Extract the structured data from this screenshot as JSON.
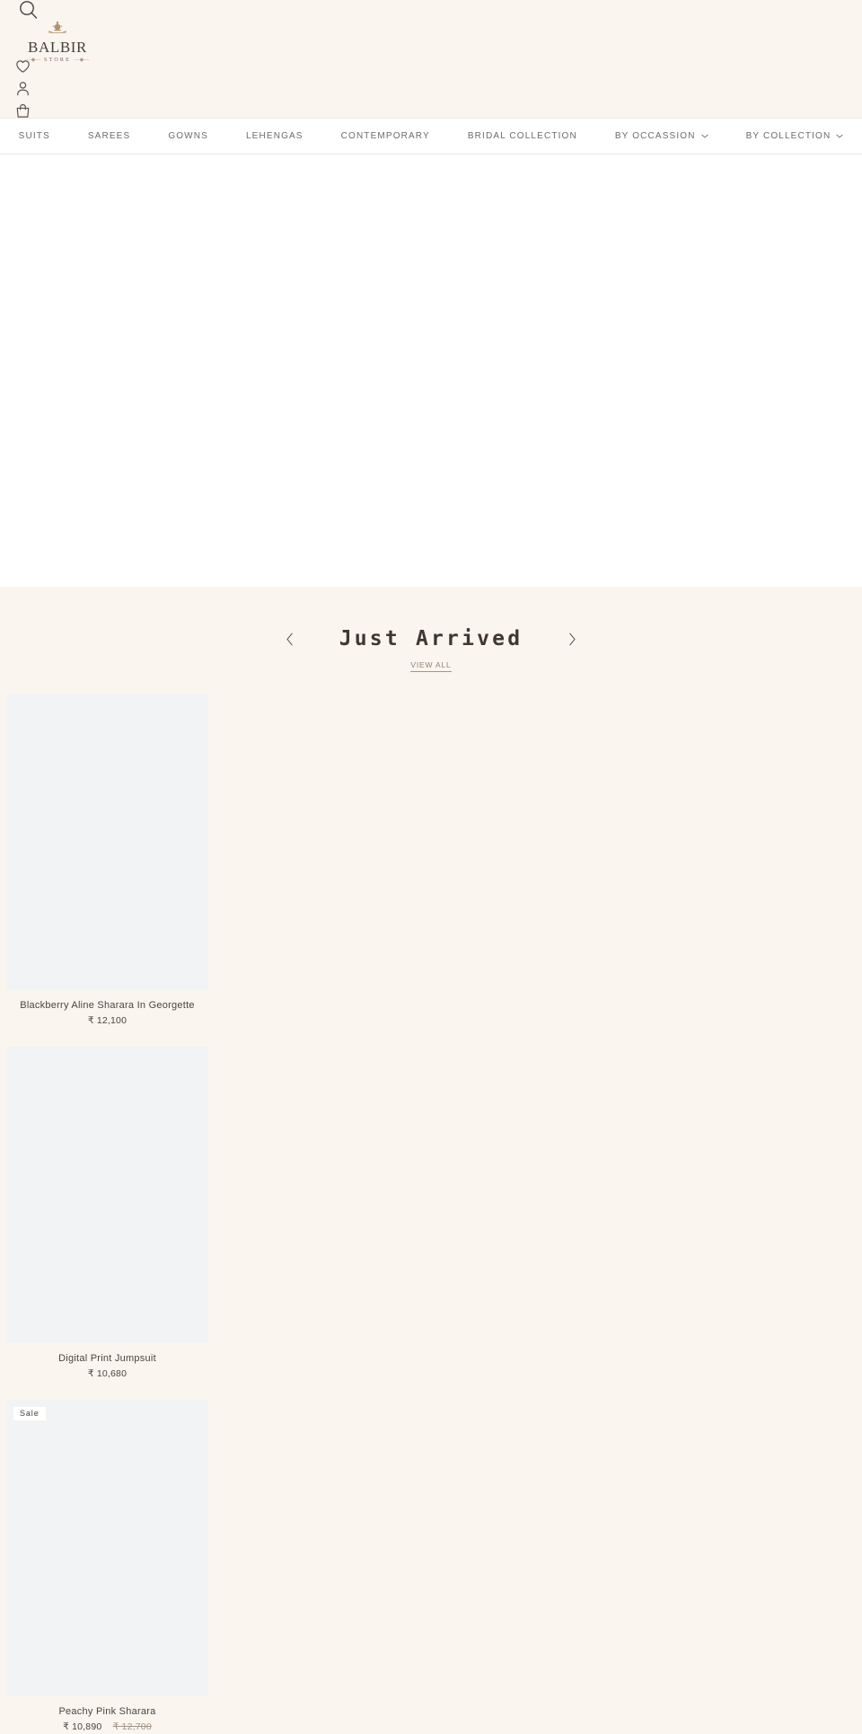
{
  "header": {
    "search_icon": "search-icon",
    "brand_name": "BALBIR",
    "brand_sub": "STORE",
    "icons": [
      {
        "name": "wishlist-icon",
        "label": "Wishlist"
      },
      {
        "name": "account-icon",
        "label": "Account"
      },
      {
        "name": "cart-icon",
        "label": "Cart"
      }
    ]
  },
  "nav": {
    "items": [
      {
        "label": "SUITS",
        "has_dropdown": false
      },
      {
        "label": "SAREES",
        "has_dropdown": false
      },
      {
        "label": "GOWNS",
        "has_dropdown": false
      },
      {
        "label": "LEHENGAS",
        "has_dropdown": false
      },
      {
        "label": "CONTEMPORARY",
        "has_dropdown": false
      },
      {
        "label": "BRIDAL COLLECTION",
        "has_dropdown": false
      },
      {
        "label": "BY OCCASSION",
        "has_dropdown": true
      },
      {
        "label": "BY COLLECTION",
        "has_dropdown": true
      }
    ]
  },
  "collection": {
    "title": "Just Arrived",
    "view_all_label": "VIEW ALL",
    "prev_label": "‹",
    "next_label": "›",
    "products": [
      {
        "title": "Blackberry Aline Sharara In Georgette",
        "price": "₹ 12,100",
        "compare_price": "",
        "badge": ""
      },
      {
        "title": "Digital Print Jumpsuit",
        "price": "₹ 10,680",
        "compare_price": "",
        "badge": ""
      },
      {
        "title": "Peachy Pink Sharara",
        "price": "₹ 10,890",
        "compare_price": "₹ 12,700",
        "badge": "Sale"
      }
    ]
  },
  "colors": {
    "page_bg": "#ffffff",
    "header_bg": "#fbf5ef",
    "section_bg": "#fbf5ef",
    "image_placeholder": "#f2f3f4",
    "text": "#4a453f",
    "muted": "#8e8277",
    "brand_gold": "#a98f66"
  }
}
